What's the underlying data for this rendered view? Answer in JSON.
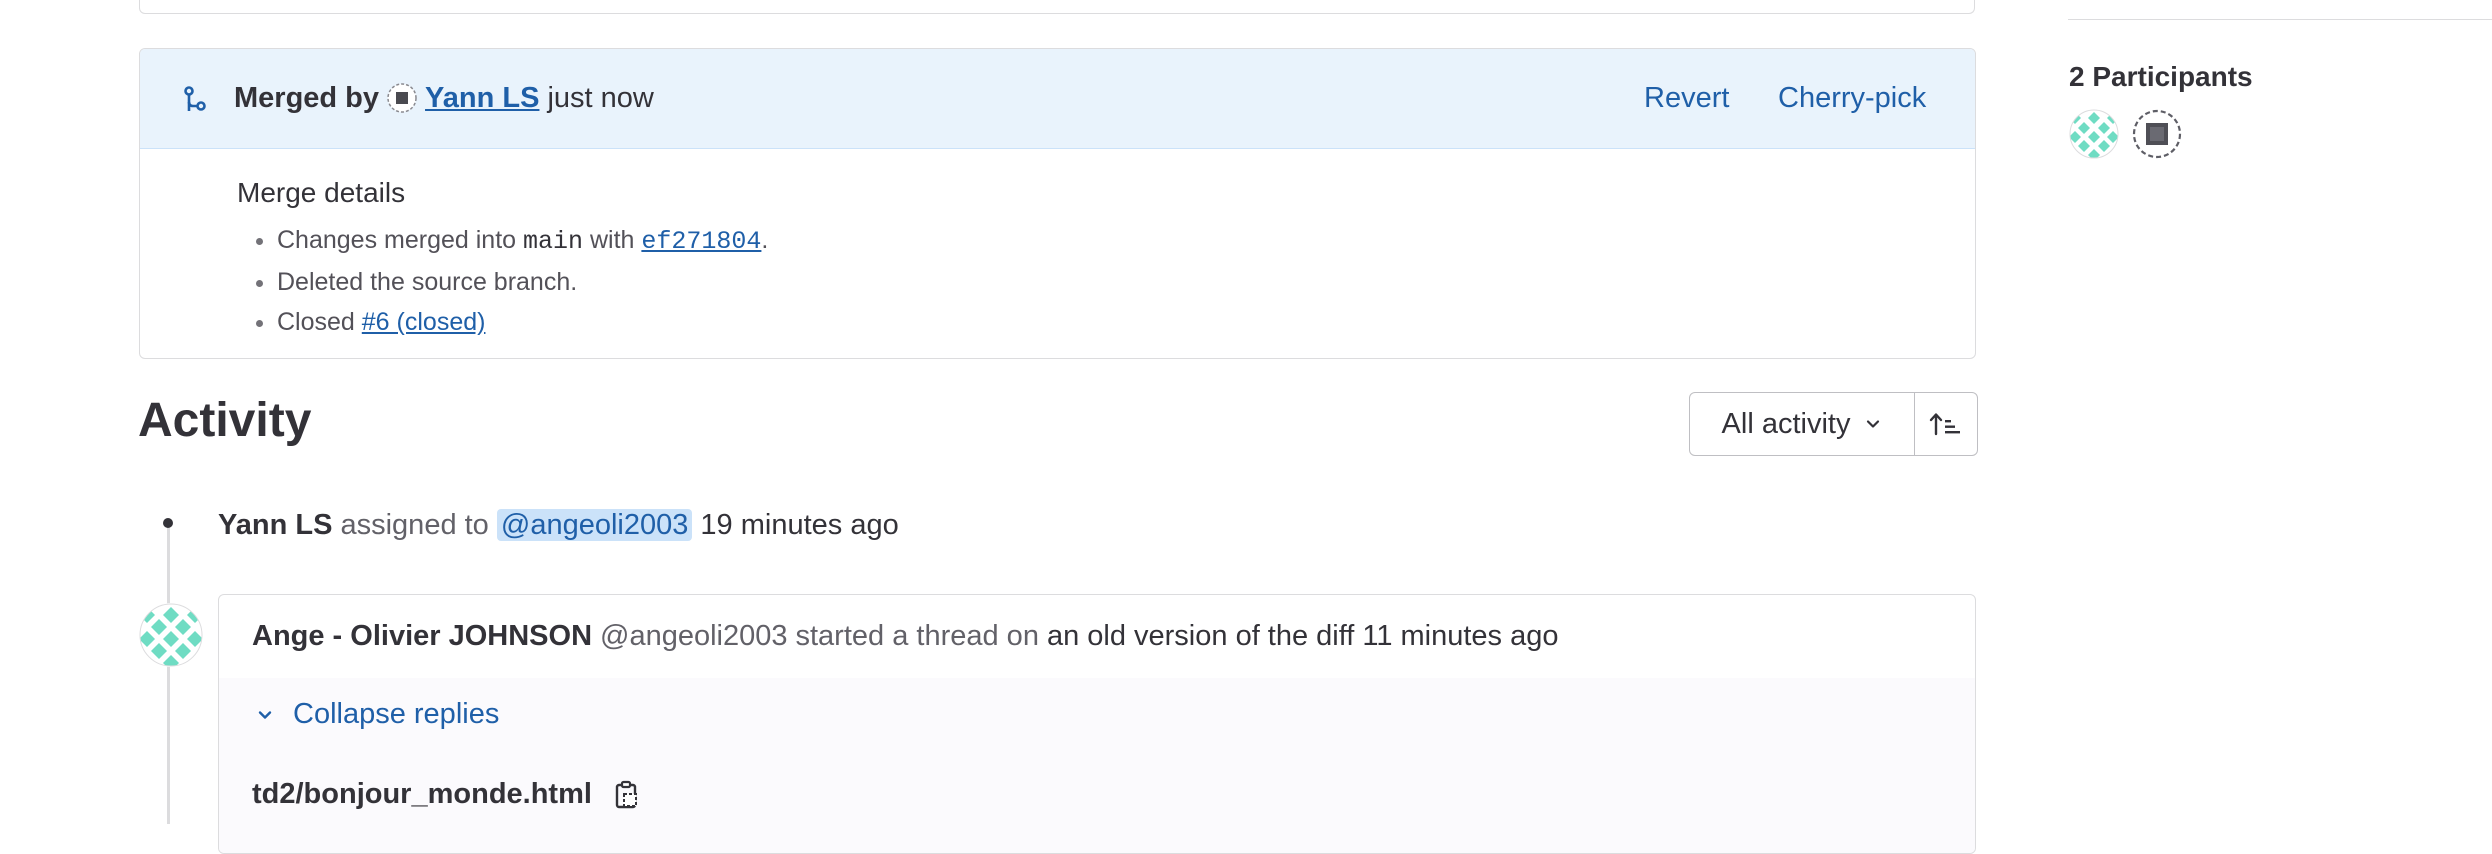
{
  "merge": {
    "merged_by_label": "Merged by",
    "user": "Yann LS",
    "when": "just now",
    "revert_label": "Revert",
    "cherry_pick_label": "Cherry-pick",
    "details_title": "Merge details",
    "details": {
      "item1_prefix": "Changes merged into",
      "item1_branch": "main",
      "item1_with": "with",
      "item1_commit": "ef271804",
      "item1_suffix": ".",
      "item2": "Deleted the source branch.",
      "item3_prefix": "Closed",
      "item3_link": "#6 (closed)"
    }
  },
  "activity": {
    "title": "Activity",
    "filter_label": "All activity",
    "system_note": {
      "author": "Yann LS",
      "action": "assigned to",
      "mention": "@angeoli2003",
      "time": "19 minutes ago"
    },
    "thread": {
      "author": "Ange - Olivier JOHNSON",
      "username": "@angeoli2003",
      "action": "started a thread on",
      "target": "an old version of the diff",
      "time": "11 minutes ago",
      "collapse_label": "Collapse replies",
      "file_path": "td2/bonjour_monde.html"
    }
  },
  "sidebar": {
    "participants_title": "2 Participants"
  },
  "colors": {
    "link": "#1f5fa8",
    "merge_header_bg": "#e9f3fc",
    "identicon": "#6fdcc3",
    "mention_bg": "#cbe2f9"
  }
}
